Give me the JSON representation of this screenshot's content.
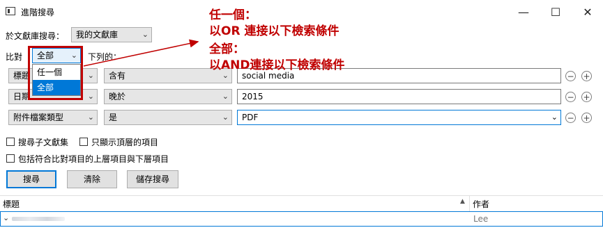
{
  "window": {
    "title": "進階搜尋",
    "minimize": "—",
    "maximize": "☐",
    "close": "✕"
  },
  "library": {
    "label": "於文獻庫搜尋：",
    "value": "我的文獻庫"
  },
  "match": {
    "label": "比對",
    "value": "全部",
    "suffix": "下列的：",
    "options": [
      "任一個",
      "全部"
    ],
    "selected_option": "全部"
  },
  "conditions": [
    {
      "field": "標題",
      "operator": "含有",
      "value": "social media"
    },
    {
      "field": "日期",
      "operator": "晚於",
      "value": "2015"
    },
    {
      "field": "附件檔案類型",
      "operator": "是",
      "value": "PDF"
    }
  ],
  "options": {
    "search_subcollections": "搜尋子文獻集",
    "show_top_items": "只顯示頂層的項目",
    "include_parent_child": "包括符合比對項目的上層項目與下層項目"
  },
  "buttons": {
    "search": "搜尋",
    "clear": "清除",
    "save": "儲存搜尋"
  },
  "results": {
    "columns": [
      "標題",
      "作者"
    ],
    "rows": [
      {
        "title": "",
        "author": "Lee"
      }
    ]
  },
  "annotation": {
    "line1": "任一個：",
    "line2": "以OR 連接以下檢索條件",
    "line3": "全部：",
    "line4": "以AND連接以下檢索條件"
  },
  "colors": {
    "annotation_red": "#c00000",
    "selection_blue": "#0078d7"
  }
}
